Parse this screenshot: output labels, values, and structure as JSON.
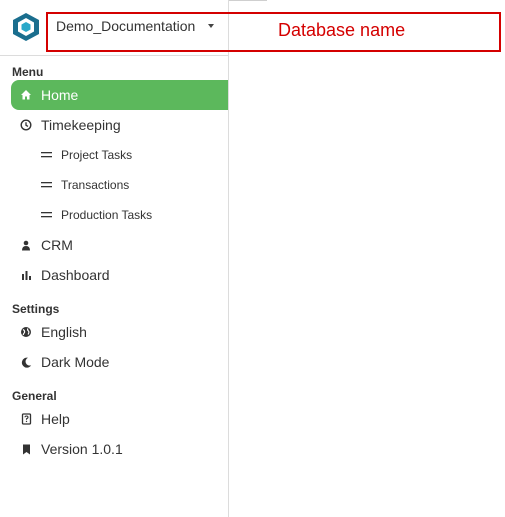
{
  "header": {
    "database_name": "Demo_Documentation",
    "annotation": "Database name"
  },
  "menu": {
    "title": "Menu",
    "items": [
      {
        "label": "Home",
        "icon": "home-icon",
        "active": true
      },
      {
        "label": "Timekeeping",
        "icon": "clock-icon"
      },
      {
        "label": "Project Tasks",
        "icon": "equals-icon"
      },
      {
        "label": "Transactions",
        "icon": "equals-icon"
      },
      {
        "label": "Production Tasks",
        "icon": "equals-icon"
      },
      {
        "label": "CRM",
        "icon": "person-icon"
      },
      {
        "label": "Dashboard",
        "icon": "bar-chart-icon"
      }
    ]
  },
  "settings": {
    "title": "Settings",
    "items": [
      {
        "label": "English",
        "icon": "globe-icon"
      },
      {
        "label": "Dark Mode",
        "icon": "moon-icon"
      }
    ]
  },
  "general": {
    "title": "General",
    "items": [
      {
        "label": "Help",
        "icon": "help-book-icon"
      },
      {
        "label": "Version 1.0.1",
        "icon": "bookmark-icon"
      }
    ]
  },
  "colors": {
    "active_bg": "#5cb85c",
    "annotation": "#d40000",
    "logo": "#1a6e8e"
  }
}
